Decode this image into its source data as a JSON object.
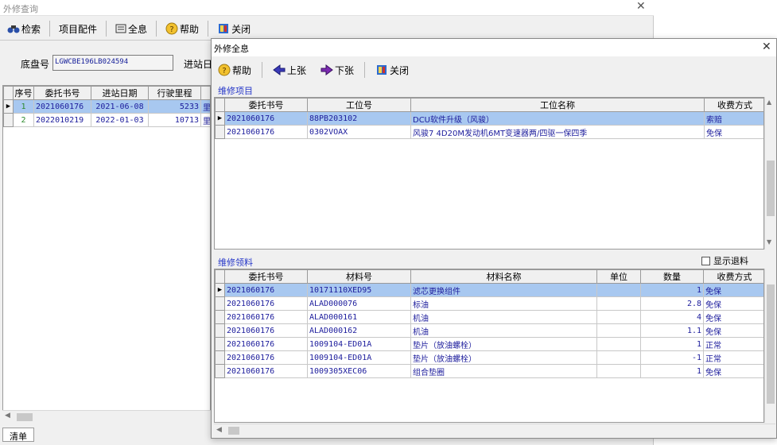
{
  "bg_window": {
    "title": "外修查询",
    "toolbar": {
      "search": "检索",
      "project_parts": "项目配件",
      "full_info": "全息",
      "help": "帮助",
      "close": "关闭"
    },
    "chassis_label": "底盘号",
    "chassis_value": "LGWCBE196LB024594",
    "arrival_label": "进站日",
    "grid_headers": [
      "序号",
      "委托书号",
      "进站日期",
      "行驶里程",
      "里"
    ],
    "grid_rows": [
      {
        "no": "1",
        "order": "2021060176",
        "date": "2021-06-08",
        "mileage": "5233",
        "extra": "里"
      },
      {
        "no": "2",
        "order": "2022010219",
        "date": "2022-01-03",
        "mileage": "10713",
        "extra": "里"
      }
    ],
    "bottom_tab": "清单"
  },
  "dialog": {
    "title": "外修全息",
    "toolbar": {
      "help": "帮助",
      "prev": "上张",
      "next": "下张",
      "close": "关闭"
    },
    "repair_section": "维修项目",
    "repair_headers": [
      "委托书号",
      "工位号",
      "工位名称",
      "收费方式"
    ],
    "repair_rows": [
      {
        "order": "2021060176",
        "station": "88PB203102",
        "name": "DCU软件升级（风骏）",
        "fee": "索赔"
      },
      {
        "order": "2021060176",
        "station": "0302VOAX",
        "name": "风骏7 4D20M发动机6MT变速器两/四驱一保四季",
        "fee": "免保"
      }
    ],
    "material_section": "维修领料",
    "show_return_label": "显示退料",
    "material_headers": [
      "委托书号",
      "材料号",
      "材料名称",
      "单位",
      "数量",
      "收费方式"
    ],
    "material_rows": [
      {
        "order": "2021060176",
        "code": "10171110XED95",
        "name": "滤芯更换组件",
        "unit": "",
        "qty": "1",
        "fee": "免保"
      },
      {
        "order": "2021060176",
        "code": "ALAD000076",
        "name": "标油",
        "unit": "",
        "qty": "2.8",
        "fee": "免保"
      },
      {
        "order": "2021060176",
        "code": "ALAD000161",
        "name": "机油",
        "unit": "",
        "qty": "4",
        "fee": "免保"
      },
      {
        "order": "2021060176",
        "code": "ALAD000162",
        "name": "机油",
        "unit": "",
        "qty": "1.1",
        "fee": "免保"
      },
      {
        "order": "2021060176",
        "code": "1009104-ED01A",
        "name": "垫片（放油螺栓）",
        "unit": "",
        "qty": "1",
        "fee": "正常"
      },
      {
        "order": "2021060176",
        "code": "1009104-ED01A",
        "name": "垫片（放油螺栓）",
        "unit": "",
        "qty": "-1",
        "fee": "正常"
      },
      {
        "order": "2021060176",
        "code": "1009305XEC06",
        "name": "组合垫圈",
        "unit": "",
        "qty": "1",
        "fee": "免保"
      }
    ]
  },
  "colors": {
    "selected_row": "#a8c8f0",
    "section_text": "#2536c8",
    "cell_text": "#1c1c9c"
  },
  "icons": [
    "binoculars-icon",
    "full-info-icon",
    "help-icon",
    "book-close-icon",
    "arrow-left-icon",
    "arrow-right-icon",
    "close-icon",
    "row-pointer-icon"
  ]
}
